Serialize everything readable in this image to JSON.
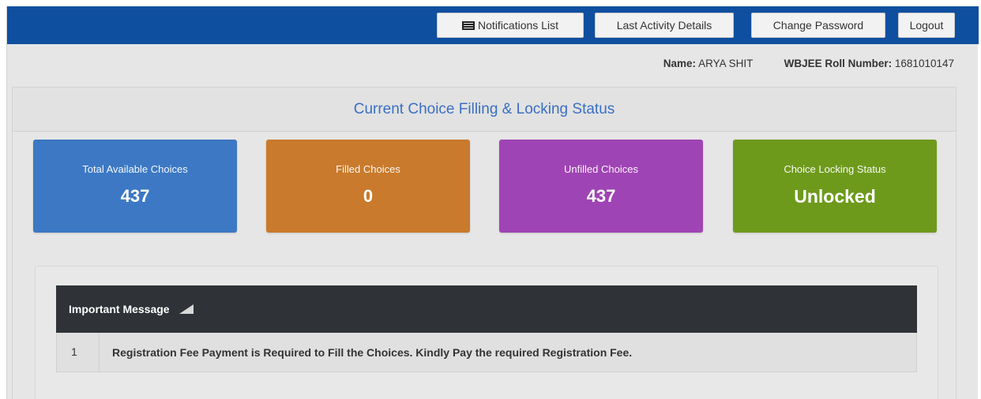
{
  "topbar": {
    "notifications_label": "Notifications List",
    "activity_label": "Last Activity Details",
    "password_label": "Change Password",
    "logout_label": "Logout",
    "bg_color": "#0f4fa0"
  },
  "user": {
    "name_label": "Name:",
    "name_value": "ARYA SHIT",
    "roll_label": "WBJEE Roll Number:",
    "roll_value": "1681010147"
  },
  "status": {
    "title": "Current Choice Filling & Locking Status",
    "cards": [
      {
        "label": "Total Available Choices",
        "value": "437",
        "color": "#3c78c4"
      },
      {
        "label": "Filled Choices",
        "value": "0",
        "color": "#c97a2c"
      },
      {
        "label": "Unfilled Choices",
        "value": "437",
        "color": "#9f44b4"
      },
      {
        "label": "Choice Locking Status",
        "value": "Unlocked",
        "color": "#6e9a1c"
      }
    ]
  },
  "messages": {
    "header": "Important Message",
    "header_icon": "megaphone-icon",
    "rows": [
      {
        "num": "1",
        "text": "Registration Fee Payment is Required to Fill the Choices. Kindly Pay the required Registration Fee."
      }
    ]
  }
}
